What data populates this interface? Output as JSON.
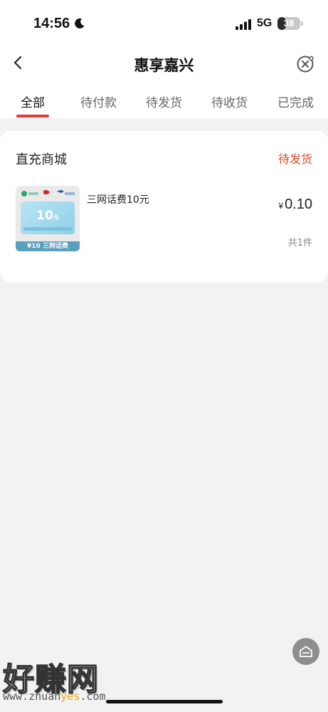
{
  "status_bar": {
    "time": "14:56",
    "network": "5G",
    "battery_level": "38",
    "battery_fraction": 0.38
  },
  "header": {
    "title": "惠享嘉兴",
    "back_icon": "chevron-left-icon",
    "close_icon": "circle-close-icon"
  },
  "tabs": [
    {
      "label": "全部",
      "active": true
    },
    {
      "label": "待付款",
      "active": false
    },
    {
      "label": "待发货",
      "active": false
    },
    {
      "label": "待收货",
      "active": false
    },
    {
      "label": "已完成",
      "active": false
    }
  ],
  "order": {
    "shop_name": "直充商城",
    "status": "待发货",
    "product": {
      "name": "三网话费10元",
      "price_symbol": "¥",
      "price": "0.10",
      "quantity_text": "共1件",
      "thumbnail": {
        "amount": "10",
        "unit": "元",
        "band_text": "¥10 三网话费"
      }
    }
  },
  "floating_button": {
    "icon": "home-icon"
  },
  "watermark": {
    "brand": "好赚网",
    "url_prefix": "www.zhuan",
    "url_highlight": "yes",
    "url_suffix": ".com"
  },
  "colors": {
    "accent": "#e03a3a",
    "status_orange": "#e0492b",
    "background": "#f2f2f2"
  }
}
